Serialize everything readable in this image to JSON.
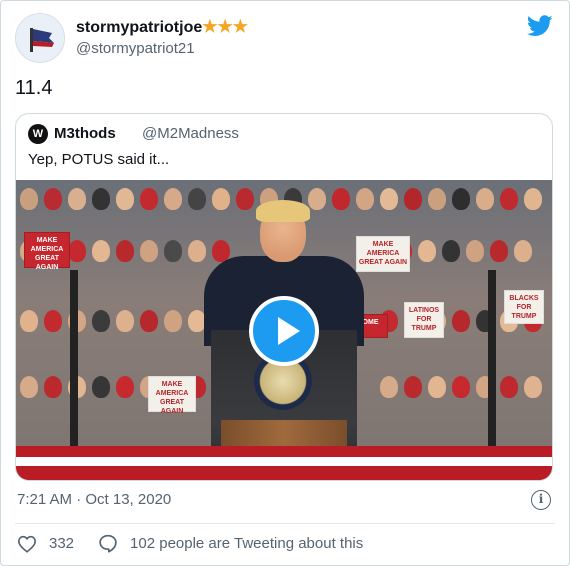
{
  "author": {
    "display_name": "stormypatriotjoe",
    "stars": "★★★",
    "handle": "@stormypatriot21"
  },
  "tweet": {
    "text": "11.4",
    "timestamp": "7:21 AM · Oct 13, 2020"
  },
  "quoted_tweet": {
    "avatar_initial": "W",
    "display_name": "M3thods",
    "handle": "@M2Madness",
    "text": "Yep, POTUS said it..."
  },
  "media": {
    "signs": [
      "MAKE AMERICA GREAT AGAIN",
      "MAKE AMERICA GREAT AGAIN",
      "MAKE AMERICA GREAT AGAIN",
      "BLACKS FOR TRUMP",
      "LATINOS FOR TRUMP",
      "HOME"
    ]
  },
  "actions": {
    "likes": "332",
    "conversation": "102 people are Tweeting about this"
  },
  "icons": {
    "twitter": "twitter-bird-icon",
    "play": "play-icon",
    "info": "info-icon",
    "like": "heart-icon",
    "reply": "speech-bubble-icon"
  },
  "colors": {
    "brand": "#1d9bf0",
    "star": "#f4a622",
    "muted": "#536471"
  }
}
